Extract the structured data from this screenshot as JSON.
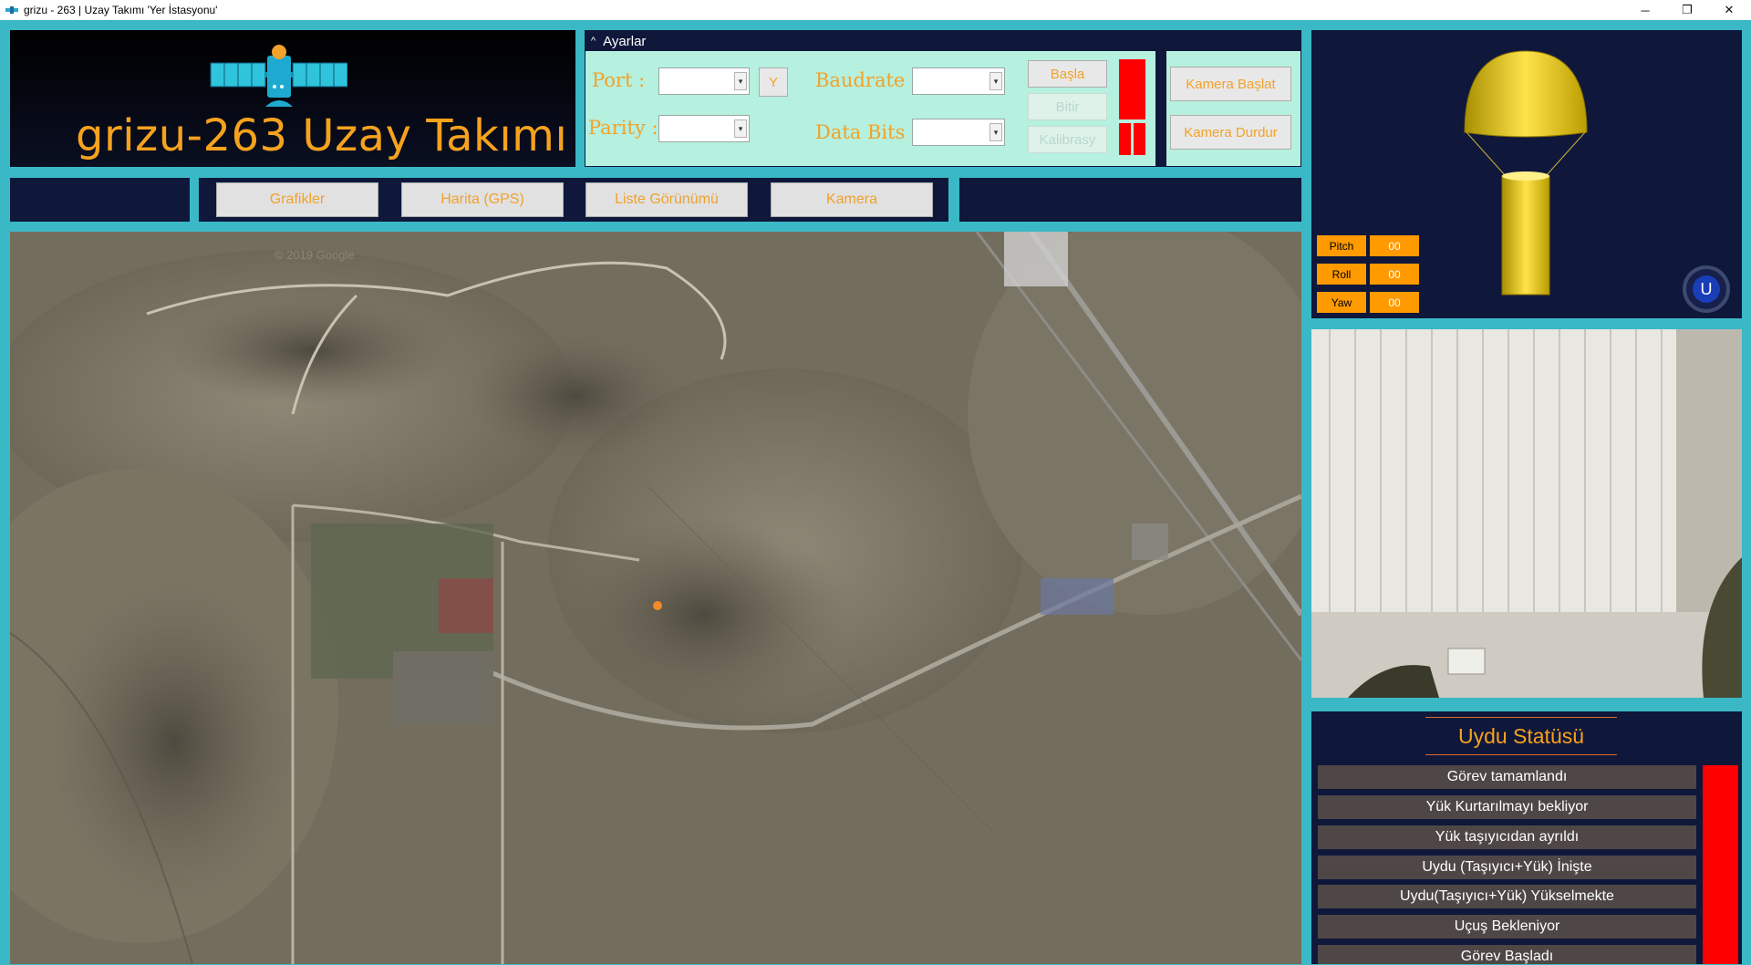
{
  "window": {
    "title": "grizu - 263 | Uzay Takımı  'Yer İstasyonu'",
    "minimize_glyph": "─",
    "restore_glyph": "❐",
    "close_glyph": "✕"
  },
  "logo": {
    "text": "grizu-263 Uzay Takımı",
    "icon": "satellite-icon"
  },
  "settings": {
    "header": "Ayarlar",
    "collapse_glyph": "^",
    "port_label": "Port   :",
    "parity_label": "Parity :",
    "baudrate_label": "Baudrate :",
    "databits_label": "Data Bits :",
    "refresh_button": "Y",
    "start_button": "Başla",
    "stop_button": "Bitir",
    "calibrate_button": "Kalibrasy",
    "camera_start_button": "Kamera Başlat",
    "camera_stop_button": "Kamera Durdur",
    "dropdown_glyph": "▾"
  },
  "nav": {
    "tabs": [
      {
        "label": "Grafikler"
      },
      {
        "label": "Harita (GPS)"
      },
      {
        "label": "Liste Görünümü"
      },
      {
        "label": "Kamera"
      }
    ]
  },
  "map": {
    "watermark": "© 2019 Google"
  },
  "attitude": {
    "pitch_label": "Pitch",
    "pitch_value": "00",
    "roll_label": "Roll",
    "roll_value": "00",
    "yaw_label": "Yaw",
    "yaw_value": "00",
    "u_button": "U"
  },
  "status": {
    "title": "Uydu Statüsü",
    "items": [
      "Görev tamamlandı",
      "Yük Kurtarılmayı bekliyor",
      "Yük taşıyıcıdan ayrıldı",
      "Uydu (Taşıyıcı+Yük) İnişte",
      "Uydu(Taşıyıcı+Yük) Yükselmekte",
      "Uçuş Bekleniyor",
      "Görev Başladı"
    ]
  },
  "colors": {
    "accent_orange": "#f0a22a",
    "panel_navy": "#0f173b",
    "frame_teal": "#3bb8c6",
    "settings_bg": "#b6f0df",
    "indicator_red": "#ff0000"
  }
}
